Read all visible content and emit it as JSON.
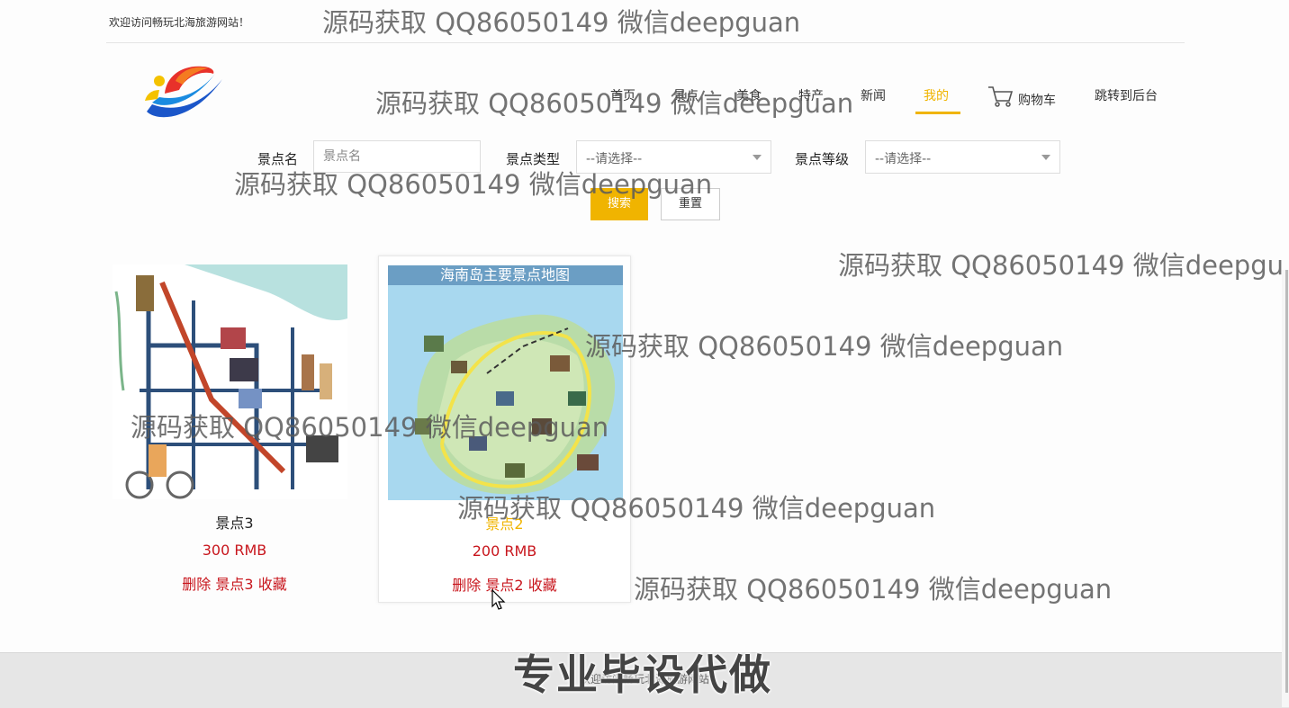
{
  "header": {
    "welcome": "欢迎访问畅玩北海旅游网站！"
  },
  "nav": {
    "items": [
      {
        "label": "首页"
      },
      {
        "label": "景点"
      },
      {
        "label": "美食"
      },
      {
        "label": "特产"
      },
      {
        "label": "新闻"
      },
      {
        "label": "我的",
        "active": true
      },
      {
        "label": "购物车"
      },
      {
        "label": "跳转到后台"
      }
    ]
  },
  "search": {
    "name_label": "景点名",
    "name_placeholder": "景点名",
    "type_label": "景点类型",
    "type_value": "--请选择--",
    "level_label": "景点等级",
    "level_value": "--请选择--",
    "search_button": "搜索",
    "reset_button": "重置"
  },
  "cards": [
    {
      "name": "景点3",
      "price": "300 RMB",
      "delete": "删除",
      "item": "景点3",
      "favorite": "收藏"
    },
    {
      "name": "景点2",
      "price": "200 RMB",
      "delete": "删除",
      "item": "景点2",
      "favorite": "收藏",
      "map_title": "海南岛主要景点地图"
    }
  ],
  "footer": {
    "text": "欢迎访问畅玩北海旅游网站"
  },
  "watermarks": [
    "源码获取 QQ86050149 微信deepguan",
    "源码获取 QQ86050149 微信deepguan",
    "源码获取 QQ86050149 微信deepguan",
    "源码获取 QQ86050149 微信deepgu",
    "源码获取 QQ86050149 微信deepguan",
    "源码获取 QQ86050149 微信deepguan",
    "源码获取 QQ86050149 微信deepguan",
    "源码获取 QQ86050149 微信deepguan"
  ],
  "banner": "专业毕设代做",
  "colors": {
    "accent": "#f0b400",
    "price": "#c8161d"
  }
}
